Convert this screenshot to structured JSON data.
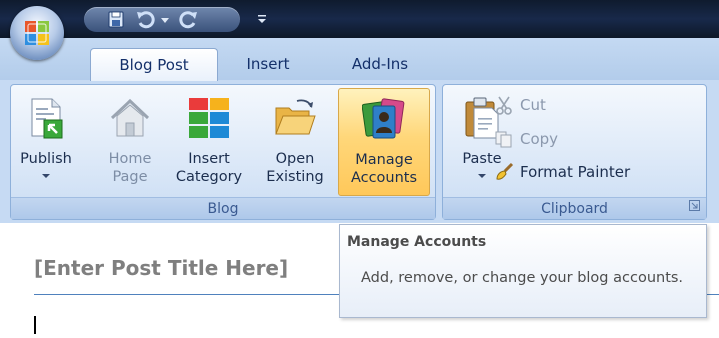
{
  "tabs": [
    "Blog Post",
    "Insert",
    "Add-Ins"
  ],
  "groups": {
    "blog": "Blog",
    "clipboard": "Clipboard"
  },
  "buttons": {
    "publish": "Publish",
    "home_page_line1": "Home",
    "home_page_line2": "Page",
    "insert_category_line1": "Insert",
    "insert_category_line2": "Category",
    "open_existing_line1": "Open",
    "open_existing_line2": "Existing",
    "manage_accounts_line1": "Manage",
    "manage_accounts_line2": "Accounts",
    "paste": "Paste",
    "cut": "Cut",
    "copy": "Copy",
    "format_painter": "Format Painter"
  },
  "document": {
    "post_title": "[Enter Post Title Here]"
  },
  "tooltip": {
    "title": "Manage Accounts",
    "description": "Add, remove, or change your blog accounts."
  },
  "icons": {
    "office": "office-button-icon",
    "save": "save-icon",
    "undo": "undo-icon",
    "redo": "redo-icon",
    "customize": "customize-toolbar-icon",
    "publish": "publish-icon",
    "home": "home-page-icon",
    "category": "insert-category-icon",
    "folder": "open-folder-icon",
    "accounts": "manage-accounts-icon",
    "paste": "paste-icon",
    "cut": "scissors-icon",
    "copy": "copy-icon",
    "painter": "paintbrush-icon"
  },
  "colors": {
    "hover_accent": "#ffc85a",
    "ribbon": "#c6daf3",
    "title_bar": "#18294a",
    "rule": "#4f81bd"
  }
}
